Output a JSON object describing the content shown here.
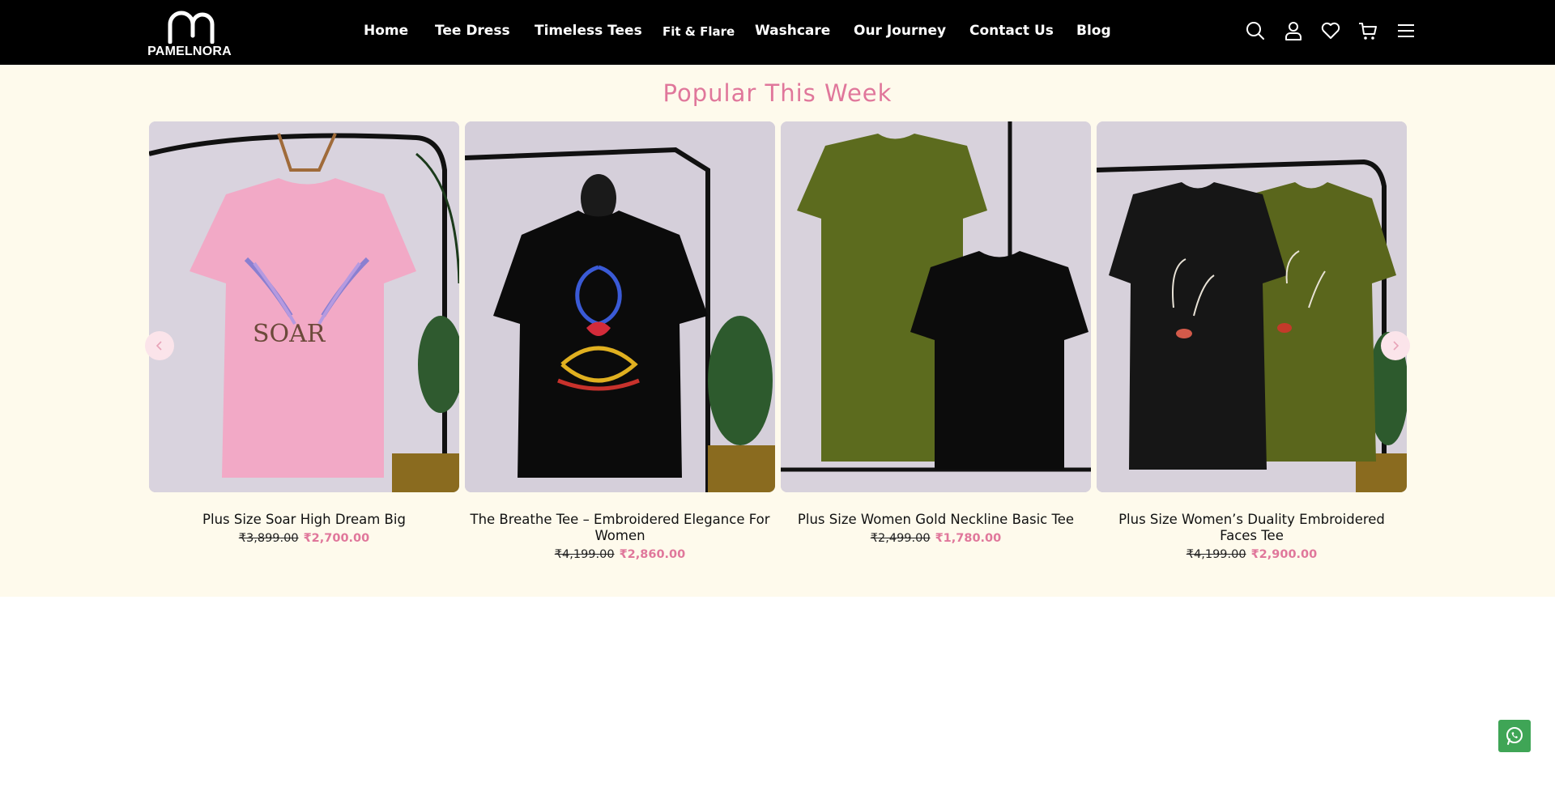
{
  "brand": {
    "name": "PAMELNORA",
    "logo_icon": "pn-monogram"
  },
  "nav": {
    "items": [
      {
        "label": "Home"
      },
      {
        "label": "Tee Dress"
      },
      {
        "label": "Timeless Tees"
      },
      {
        "label": "Fit & Flare"
      },
      {
        "label": "Washcare"
      },
      {
        "label": "Our Journey"
      },
      {
        "label": "Contact Us"
      },
      {
        "label": "Blog"
      }
    ]
  },
  "header_icons": [
    "search-icon",
    "account-icon",
    "wishlist-icon",
    "cart-icon",
    "menu-icon"
  ],
  "section": {
    "title": "Popular This Week",
    "products": [
      {
        "name": "Plus Size Soar High Dream Big",
        "old_price": "₹3,899.00",
        "price": "₹2,700.00",
        "image": "pink-tee-soar"
      },
      {
        "name": "The Breathe Tee – Embroidered Elegance For Women",
        "old_price": "₹4,199.00",
        "price": "₹2,860.00",
        "image": "black-tee-breathe"
      },
      {
        "name": "Plus Size Women Gold Neckline Basic Tee",
        "old_price": "₹2,499.00",
        "price": "₹1,780.00",
        "image": "olive-and-black-tees"
      },
      {
        "name": "Plus Size Women’s Duality Embroidered Faces Tee",
        "old_price": "₹4,199.00",
        "price": "₹2,900.00",
        "image": "black-and-olive-faces-tees"
      }
    ]
  },
  "colors": {
    "accent": "#e0779b",
    "section_bg": "#fefaec",
    "header_bg": "#000000",
    "whatsapp": "#3fa556"
  }
}
